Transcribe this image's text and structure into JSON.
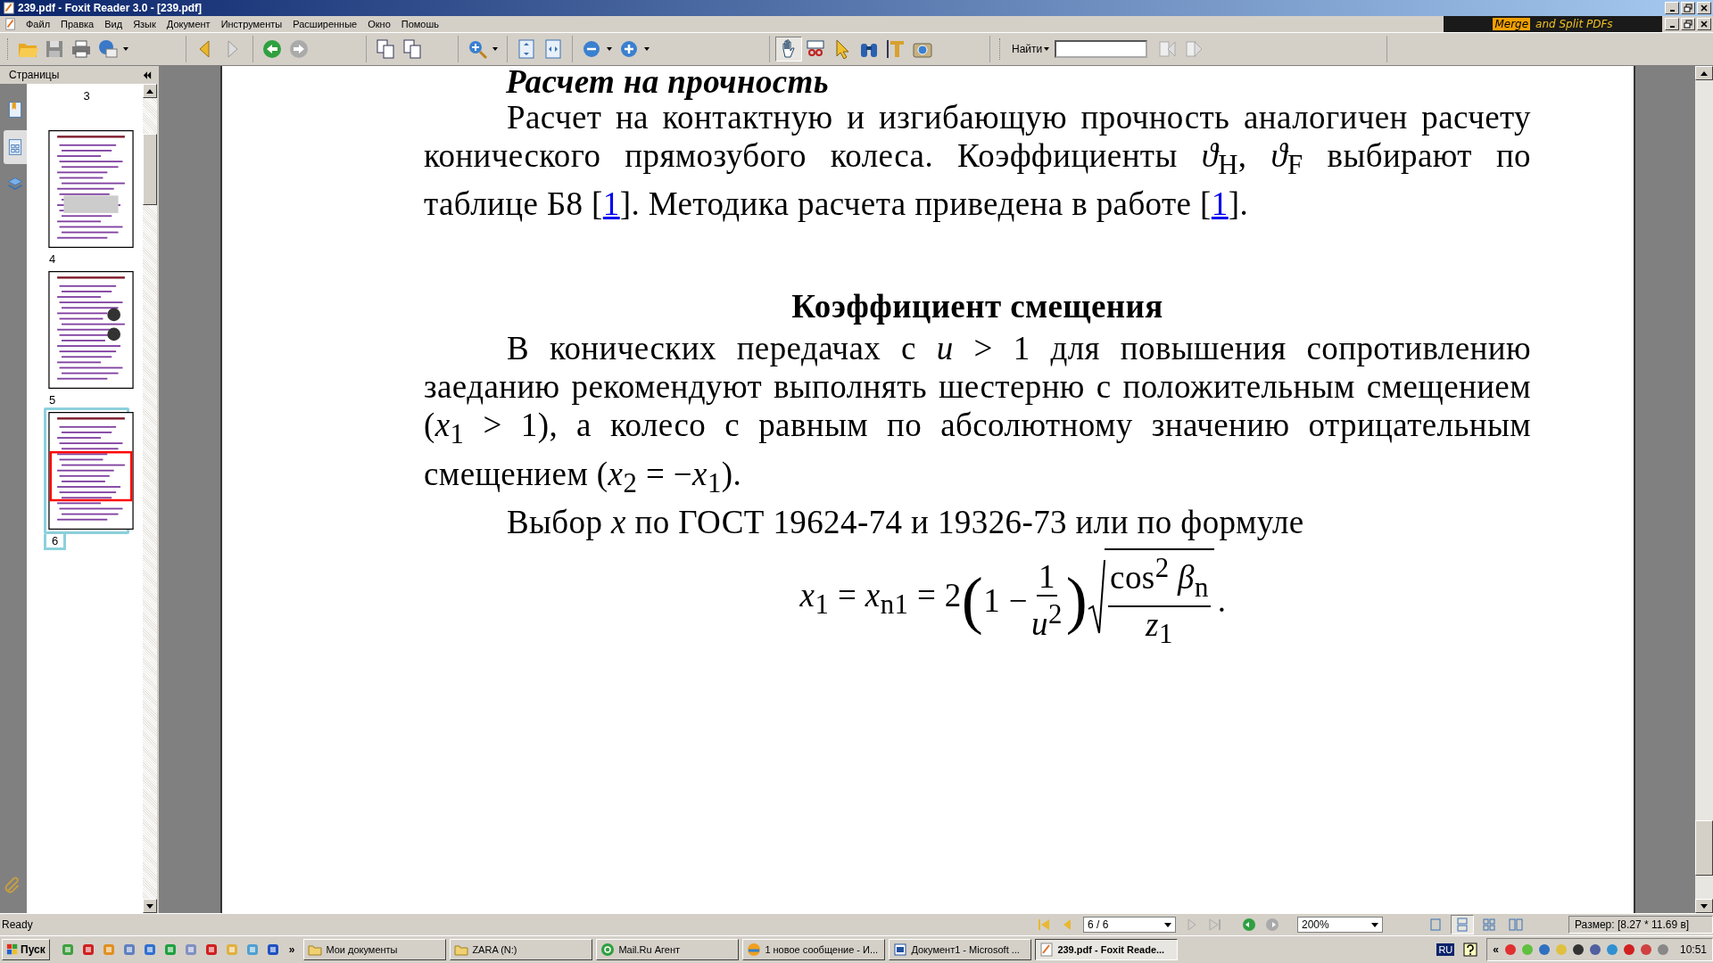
{
  "window": {
    "title": "239.pdf - Foxit Reader 3.0 - [239.pdf]"
  },
  "menu": [
    "Файл",
    "Правка",
    "Вид",
    "Язык",
    "Документ",
    "Инструменты",
    "Расширенные",
    "Окно",
    "Помошь"
  ],
  "ad": {
    "highlight": "Merge",
    "text": "and Split PDFs"
  },
  "find": {
    "label": "Найти"
  },
  "sidebar": {
    "title": "Страницы",
    "tabs": [
      {
        "selected": false
      },
      {
        "selected": true
      },
      {
        "selected": false
      }
    ],
    "pages": [
      {
        "label": "3",
        "kind": "label",
        "selected": false
      },
      {
        "label": "4",
        "kind": "thumb",
        "selected": false
      },
      {
        "label": "5",
        "kind": "thumb",
        "selected": false
      },
      {
        "label": "6",
        "kind": "thumb",
        "selected": true
      }
    ]
  },
  "document": {
    "heading_top": "Расчет на прочность",
    "paragraph_1": [
      {
        "kind": "text",
        "text": "Расчет на контактную и изгибающую прочность аналогичен расчету конического прямозубого колеса. Коэффициенты *ϑ*$_{H}$, *ϑ*$_{F}$ выбирают по таблице Б8 ["
      },
      {
        "kind": "link",
        "text": "1"
      },
      {
        "kind": "text",
        "text": "]. Методика расчета приведена в работе ["
      },
      {
        "kind": "link",
        "text": "1"
      },
      {
        "kind": "text",
        "text": "]."
      }
    ],
    "heading": "Коэффициент смещения",
    "paragraph_2": "В конических передачах с *u* > 1 для повышения сопротивлению заеданию рекомендуют выполнять шестерню с положительным смещением (*x*$_{1}$ > 1), а колесо с равным по абсолютному значению отрицательным смещением (*x*$_{2}$ = −*x*$_{1}$).",
    "paragraph_3": "Выбор *x* по ГОСТ 19624-74 и 19326-73 или по формуле",
    "formula": {
      "lhs": "*x*$_{1}$ = *x*$_{n1}$ = 2",
      "open": "(",
      "inner": "1 −",
      "frac_num": "1",
      "frac_den": "*u*$^{2}$",
      "close": ")",
      "root_num": "cos$^{2}$ *β*$_{n}$",
      "root_den": "*z*$_{1}$",
      "tail": "."
    }
  },
  "status": {
    "text": "Ready",
    "page": "6 / 6",
    "zoom": "200%",
    "views": [
      {
        "selected": false
      },
      {
        "selected": true
      },
      {
        "selected": false
      },
      {
        "selected": false
      }
    ],
    "size": "Размер: [8.27 * 11.69 в]"
  },
  "taskbar": {
    "start": "Пуск",
    "more": "»",
    "tasks": [
      {
        "label": "Мои документы",
        "selected": false,
        "kind": "folder"
      },
      {
        "label": "ZARA (N:)",
        "selected": false,
        "kind": "folder"
      },
      {
        "label": "Mail.Ru Агент",
        "selected": false,
        "kind": "agent"
      },
      {
        "label": "1 новое сообщение - И...",
        "selected": false,
        "kind": "chat"
      },
      {
        "label": "Документ1 - Microsoft ...",
        "selected": false,
        "kind": "word"
      },
      {
        "label": "239.pdf - Foxit Reade...",
        "selected": true,
        "kind": "pdf"
      }
    ],
    "lang": "RU",
    "expand": "«",
    "clock": "10:51"
  }
}
